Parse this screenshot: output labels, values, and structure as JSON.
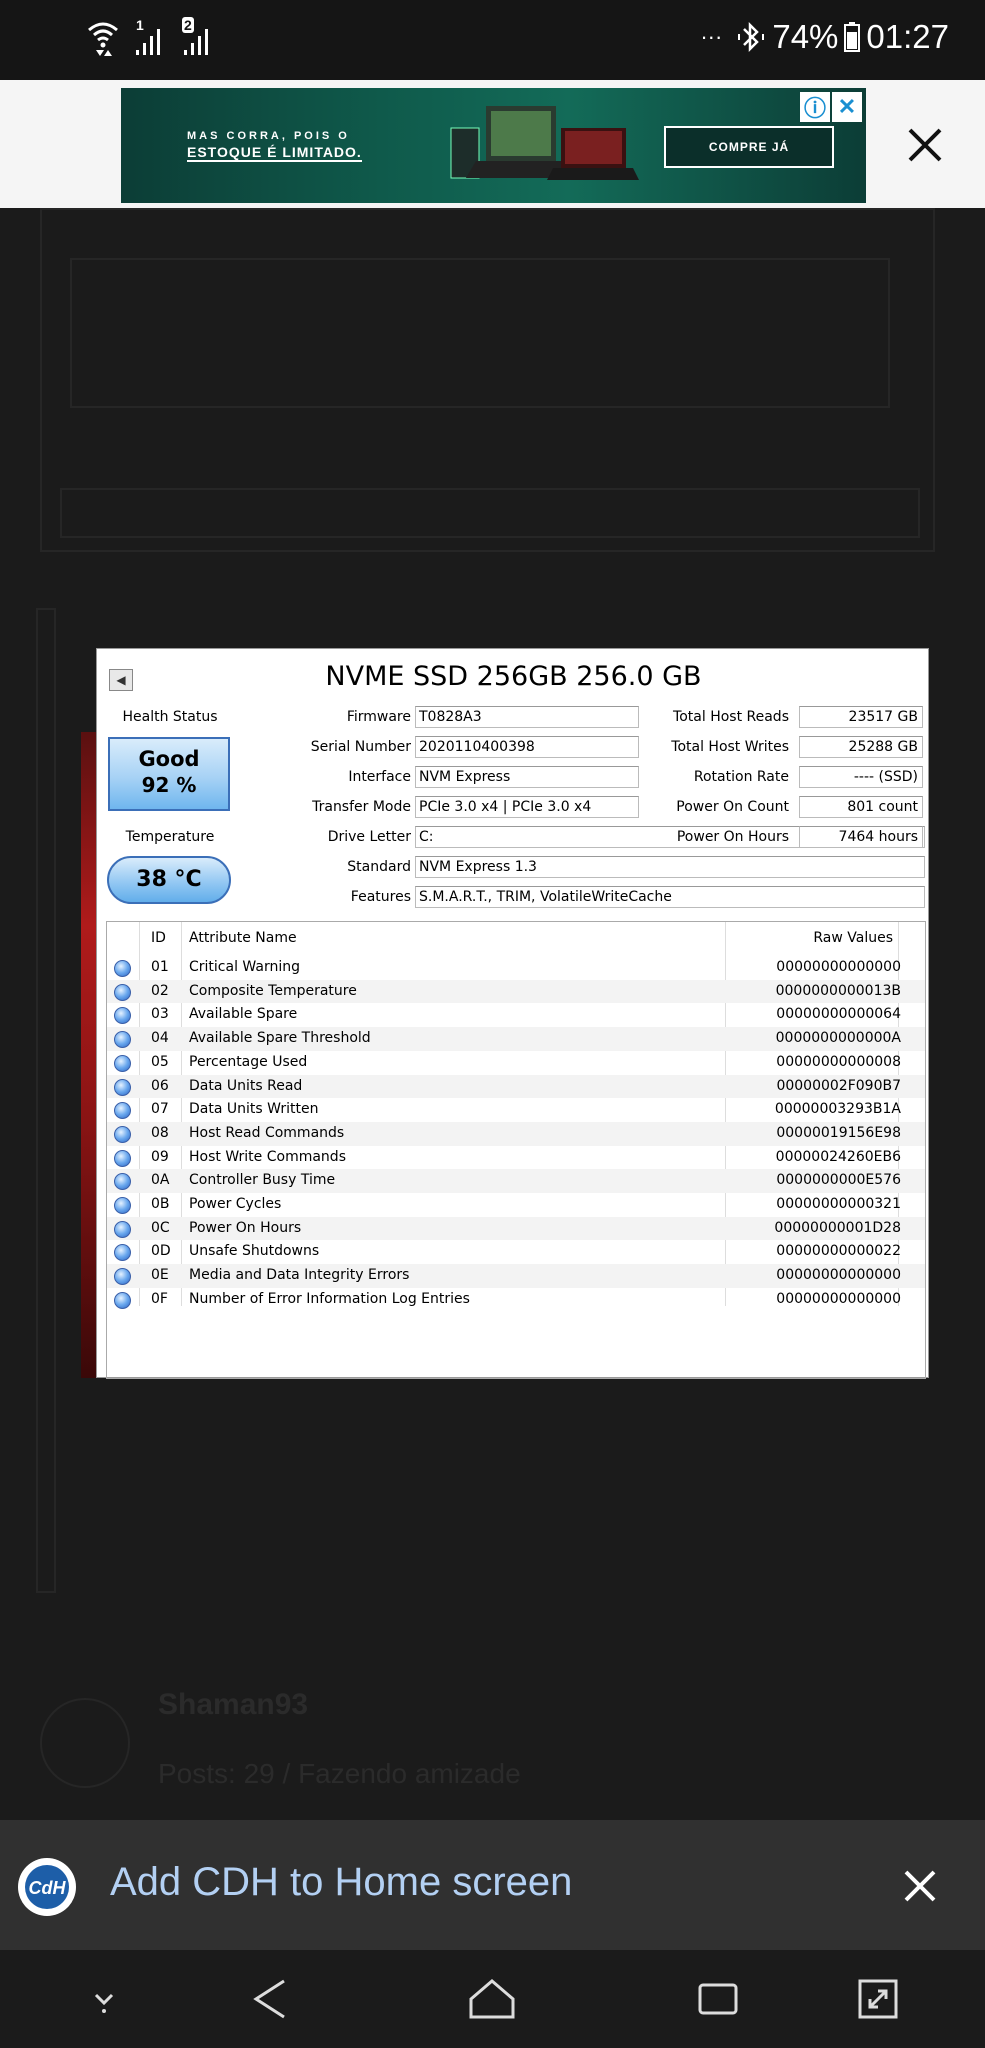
{
  "status_bar": {
    "battery": "74%",
    "time": "01:27",
    "sim1": "1",
    "sim2": "2",
    "more": "···"
  },
  "ad": {
    "line1": "MAS CORRA, POIS O",
    "line2": "ESTOQUE É LIMITADO.",
    "cta": "COMPRE JÁ"
  },
  "cdi": {
    "title": "NVME SSD 256GB 256.0 GB",
    "health_status_label": "Health Status",
    "health_value": "Good",
    "health_percent": "92 %",
    "temperature_label": "Temperature",
    "temperature_value": "38 °C",
    "firmware_label": "Firmware",
    "firmware": "T0828A3",
    "serial_label": "Serial Number",
    "serial": "2020110400398",
    "interface_label": "Interface",
    "interface": "NVM Express",
    "transfer_label": "Transfer Mode",
    "transfer": "PCIe 3.0 x4 | PCIe 3.0 x4",
    "drive_letter_label": "Drive Letter",
    "drive_letter": "C:",
    "standard_label": "Standard",
    "standard": "NVM Express 1.3",
    "features_label": "Features",
    "features": "S.M.A.R.T., TRIM, VolatileWriteCache",
    "reads_label": "Total Host Reads",
    "reads": "23517 GB",
    "writes_label": "Total Host Writes",
    "writes": "25288 GB",
    "rotation_label": "Rotation Rate",
    "rotation": "---- (SSD)",
    "power_count_label": "Power On Count",
    "power_count": "801 count",
    "power_hours_label": "Power On Hours",
    "power_hours": "7464 hours",
    "table_headers": {
      "id": "ID",
      "name": "Attribute Name",
      "raw": "Raw Values"
    },
    "attributes": [
      {
        "id": "01",
        "name": "Critical Warning",
        "raw": "00000000000000"
      },
      {
        "id": "02",
        "name": "Composite Temperature",
        "raw": "0000000000013B"
      },
      {
        "id": "03",
        "name": "Available Spare",
        "raw": "00000000000064"
      },
      {
        "id": "04",
        "name": "Available Spare Threshold",
        "raw": "0000000000000A"
      },
      {
        "id": "05",
        "name": "Percentage Used",
        "raw": "00000000000008"
      },
      {
        "id": "06",
        "name": "Data Units Read",
        "raw": "00000002F090B7"
      },
      {
        "id": "07",
        "name": "Data Units Written",
        "raw": "00000003293B1A"
      },
      {
        "id": "08",
        "name": "Host Read Commands",
        "raw": "00000019156E98"
      },
      {
        "id": "09",
        "name": "Host Write Commands",
        "raw": "00000024260EB6"
      },
      {
        "id": "0A",
        "name": "Controller Busy Time",
        "raw": "0000000000E576"
      },
      {
        "id": "0B",
        "name": "Power Cycles",
        "raw": "00000000000321"
      },
      {
        "id": "0C",
        "name": "Power On Hours",
        "raw": "00000000001D28"
      },
      {
        "id": "0D",
        "name": "Unsafe Shutdowns",
        "raw": "00000000000022"
      },
      {
        "id": "0E",
        "name": "Media and Data Integrity Errors",
        "raw": "00000000000000"
      },
      {
        "id": "0F",
        "name": "Number of Error Information Log Entries",
        "raw": "00000000000000"
      }
    ]
  },
  "background_page": {
    "username": "Shaman93",
    "subtitle": "Posts: 29 / Fazendo amizade"
  },
  "add_to_home": {
    "text": "Add CDH to Home screen",
    "logo_text": "CdH"
  },
  "colors": {
    "accent_link": "#b3d0f3",
    "health_blue": "#3b6fb8"
  }
}
